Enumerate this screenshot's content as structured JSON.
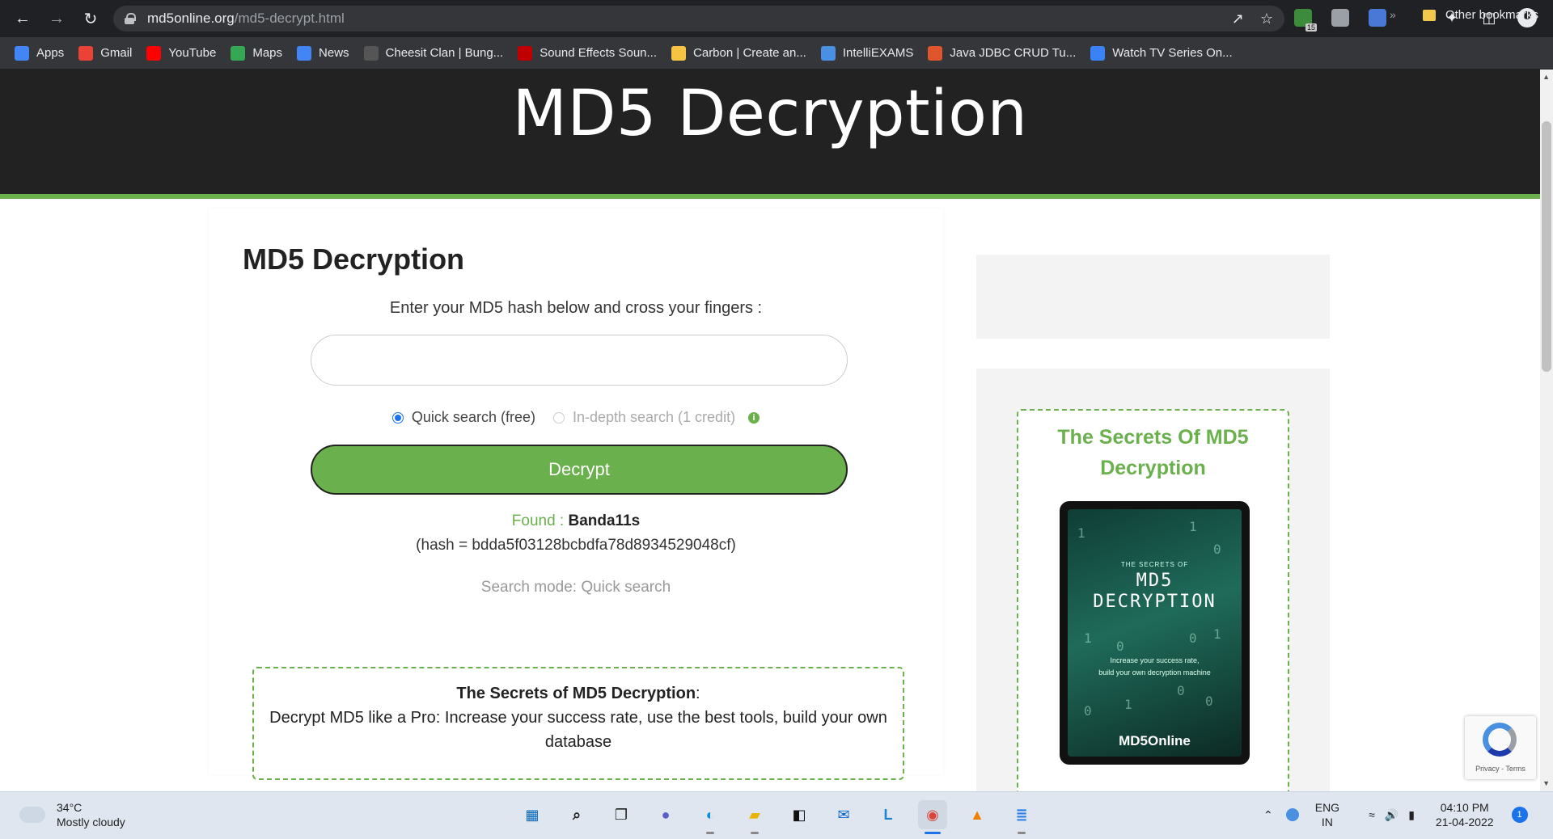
{
  "browser": {
    "url_host": "md5online.org",
    "url_path": "/md5-decrypt.html",
    "extension_badge": "15",
    "bookmarks": [
      {
        "label": "Apps",
        "icon": "apps-grid-icon",
        "color": "#4285f4"
      },
      {
        "label": "Gmail",
        "icon": "google-icon",
        "color": "#ea4335"
      },
      {
        "label": "YouTube",
        "icon": "youtube-icon",
        "color": "#ff0000"
      },
      {
        "label": "Maps",
        "icon": "maps-pin-icon",
        "color": "#34a853"
      },
      {
        "label": "News",
        "icon": "news-icon",
        "color": "#4285f4"
      },
      {
        "label": "Cheesit Clan | Bung...",
        "icon": "shield-icon",
        "color": "#555555"
      },
      {
        "label": "Sound Effects Soun...",
        "icon": "red-circle-icon",
        "color": "#c00000"
      },
      {
        "label": "Carbon | Create an...",
        "icon": "carbon-icon",
        "color": "#f6c343"
      },
      {
        "label": "IntelliEXAMS",
        "icon": "x-icon",
        "color": "#4a90e2"
      },
      {
        "label": "Java JDBC CRUD Tu...",
        "icon": "java-icon",
        "color": "#e0552c"
      },
      {
        "label": "Watch TV Series On...",
        "icon": "tv-icon",
        "color": "#3b82f6"
      }
    ],
    "other_bookmarks": "Other bookmarks",
    "more_bookmarks": "»"
  },
  "page": {
    "hero_title": "MD5 Decryption",
    "card": {
      "heading": "MD5 Decryption",
      "intro": "Enter your MD5 hash below and cross your fingers :",
      "input_value": "",
      "mode_quick": "Quick search (free)",
      "mode_indepth": "In-depth search (1 credit)",
      "decrypt_label": "Decrypt",
      "found_label": "Found :",
      "found_value": "Banda11s",
      "hash_line": "(hash = bdda5f03128bcbdfa78d8934529048cf)",
      "search_mode": "Search mode: Quick search",
      "secrets_title": "The Secrets of MD5 Decryption",
      "secrets_colon": ":",
      "secrets_text_1": "Decrypt MD5 like a Pro: Increase your success rate, use the best tools, build your own",
      "secrets_text_2": "database"
    },
    "sidebar": {
      "book_title_line1": "The Secrets Of MD5",
      "book_title_line2": "Decryption",
      "cover_small": "THE SECRETS OF",
      "cover_big1": "MD5",
      "cover_big2": "DECRYPTION",
      "cover_tag1": "Increase your success rate,",
      "cover_tag2": "build your own decryption machine",
      "cover_brand": "MD5Online"
    },
    "recaptcha_text": "Privacy - Terms",
    "accent_color": "#6ab04c"
  },
  "taskbar": {
    "temperature": "34°C",
    "weather": "Mostly cloudy",
    "lang_line1": "ENG",
    "lang_line2": "IN",
    "time": "04:10 PM",
    "date": "21-04-2022",
    "notification_count": "1",
    "apps": [
      "windows-start-icon",
      "search-icon",
      "task-view-icon",
      "teams-chat-icon",
      "edge-icon",
      "file-explorer-icon",
      "dolby-icon",
      "mail-icon",
      "l-app-icon",
      "chrome-icon",
      "vlc-icon",
      "notepad-icon"
    ]
  }
}
